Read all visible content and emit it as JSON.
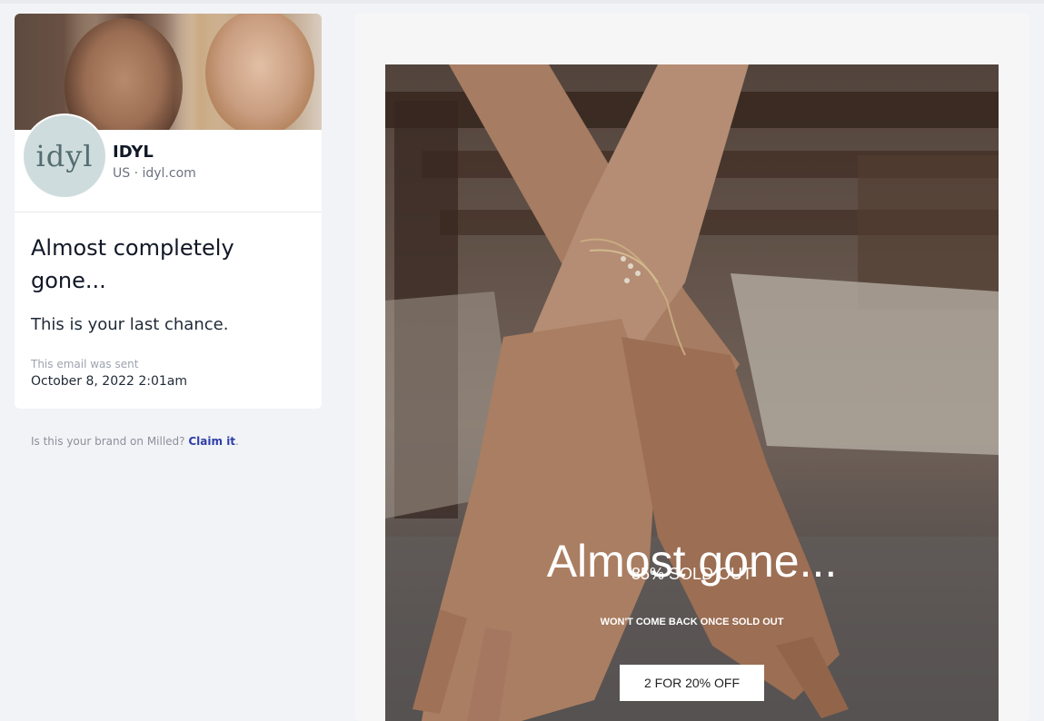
{
  "brand": {
    "name": "IDYL",
    "meta": "US · idyl.com",
    "logo_text": "idyl"
  },
  "email": {
    "subject": "Almost completely gone...",
    "preview": "This is your last chance.",
    "sent_label": "This email was sent",
    "sent_date": "October 8, 2022 2:01am"
  },
  "claim": {
    "text": "Is this your brand on Milled?",
    "link": "Claim it",
    "suffix": "."
  },
  "hero": {
    "title": "Almost gone...",
    "subtitle": "85% SOLD OUT",
    "note": "WON'T COME BACK ONCE SOLD OUT",
    "cta_label": "2 FOR 20% OFF"
  }
}
